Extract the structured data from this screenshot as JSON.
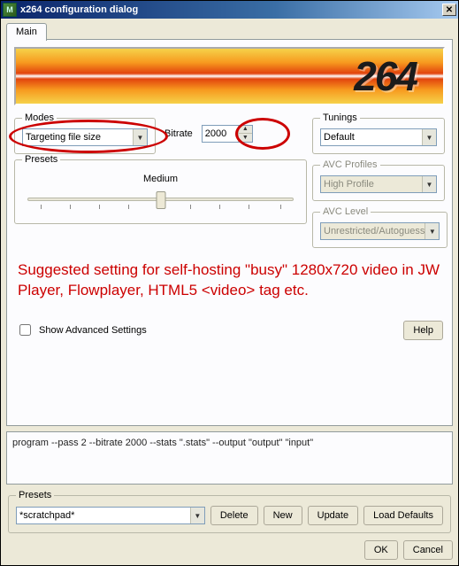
{
  "window": {
    "title": "x264 configuration dialog",
    "icon_glyph": "M"
  },
  "tabs": {
    "main": "Main"
  },
  "banner": {
    "text": "264"
  },
  "modes": {
    "legend": "Modes",
    "selected": "Targeting file size",
    "bitrate_label": "Bitrate",
    "bitrate_value": "2000"
  },
  "tunings": {
    "legend": "Tunings",
    "selected": "Default"
  },
  "presets_slider": {
    "legend": "Presets",
    "label": "Medium",
    "ticks": 9,
    "position_percent": 50
  },
  "avc_profiles": {
    "legend": "AVC Profiles",
    "selected": "High Profile"
  },
  "avc_level": {
    "legend": "AVC Level",
    "selected": "Unrestricted/Autoguess"
  },
  "annotation": "Suggested setting for self-hosting \"busy\" 1280x720 video in JW Player, Flowplayer, HTML5 <video> tag etc.",
  "advanced": {
    "checkbox_label": "Show Advanced Settings",
    "checked": false
  },
  "help_button": "Help",
  "command_line": "program --pass 2 --bitrate 2000 --stats \".stats\" --output \"output\" \"input\"",
  "bottom_presets": {
    "legend": "Presets",
    "selected": "*scratchpad*",
    "buttons": {
      "delete": "Delete",
      "new": "New",
      "update": "Update",
      "load_defaults": "Load Defaults"
    }
  },
  "dialog_buttons": {
    "ok": "OK",
    "cancel": "Cancel"
  }
}
